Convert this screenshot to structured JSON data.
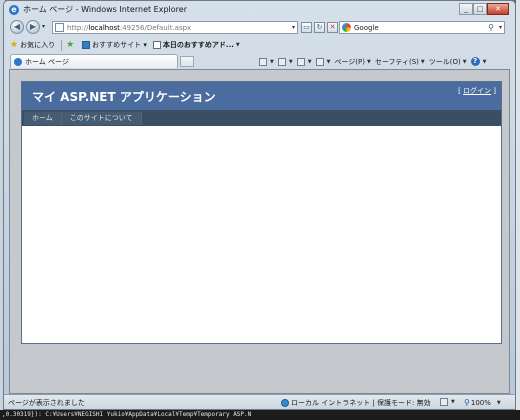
{
  "window": {
    "title": "ホーム ページ - Windows Internet Explorer",
    "minimize": "_",
    "maximize": "□",
    "close": "✕"
  },
  "address_bar": {
    "scheme": "http://",
    "host": "localhost",
    "path": ":49256/Default.aspx",
    "refresh_icon": "refresh-icon",
    "stop_icon": "stop-icon"
  },
  "search": {
    "provider": "Google"
  },
  "favorites_bar": {
    "favorites_label": "お気に入り",
    "items": [
      {
        "label": "おすすめサイト ▾"
      },
      {
        "label": "本日のおすすめアド..."
      }
    ]
  },
  "tab": {
    "label": "ホーム ページ"
  },
  "command_bar": {
    "page": "ページ(P)",
    "safety": "セーフティ(S)",
    "tools": "ツール(O)"
  },
  "site": {
    "title": "マイ ASP.NET アプリケーション",
    "login_prefix": "[ ",
    "login_link": "ログイン",
    "login_suffix": " ]",
    "nav": [
      {
        "label": "ホーム"
      },
      {
        "label": "このサイトについて"
      }
    ]
  },
  "status": {
    "text": "ページが表示されました",
    "zone": "ローカル イントラネット | 保護モード: 無効",
    "zoom": "100%"
  },
  "desktop": {
    "console_text": ",0.30319}): C:¥Users¥NEGISHI Yukio¥AppData¥Local¥Temp¥Temporary ASP.N"
  }
}
